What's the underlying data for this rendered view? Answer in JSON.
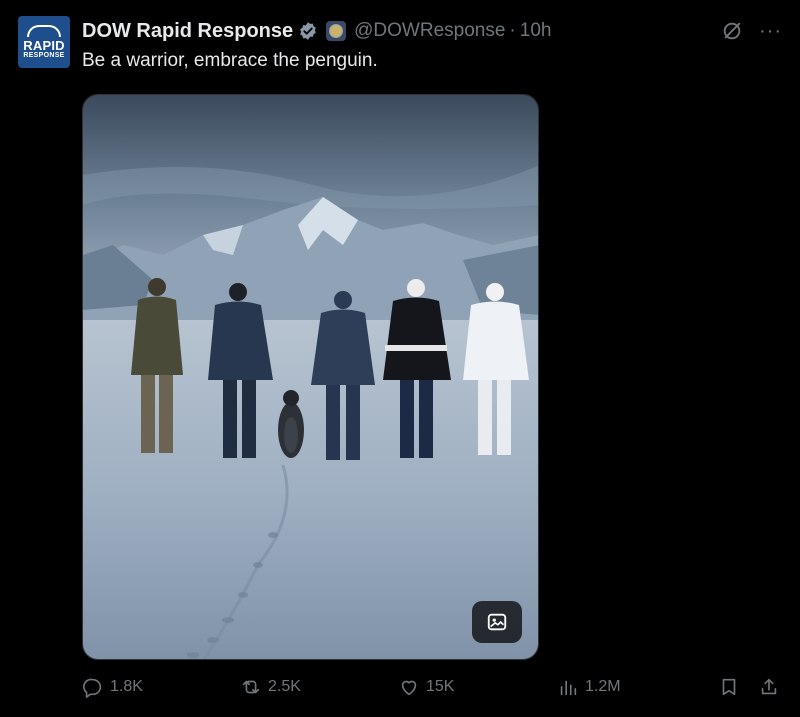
{
  "author": {
    "avatar_line1": "RAPID",
    "avatar_line2": "RESPONSE",
    "name": "DOW Rapid Response",
    "handle": "@DOWResponse",
    "separator": "·",
    "time": "10h"
  },
  "post": {
    "text": "Be a warrior, embrace the penguin."
  },
  "menu": {
    "more_label": "···"
  },
  "stats": {
    "replies": "1.8K",
    "reposts": "2.5K",
    "likes": "15K",
    "views": "1.2M"
  },
  "colors": {
    "background": "#000000",
    "primary_text": "#e7e9ea",
    "secondary_text": "#71767b",
    "verified": "#1d9bf0"
  },
  "icons": [
    "verified-badge-icon",
    "affiliate-seal-icon",
    "grok-icon",
    "more-icon",
    "alt-text-icon",
    "reply-icon",
    "repost-icon",
    "like-icon",
    "views-icon",
    "bookmark-icon",
    "share-icon"
  ]
}
